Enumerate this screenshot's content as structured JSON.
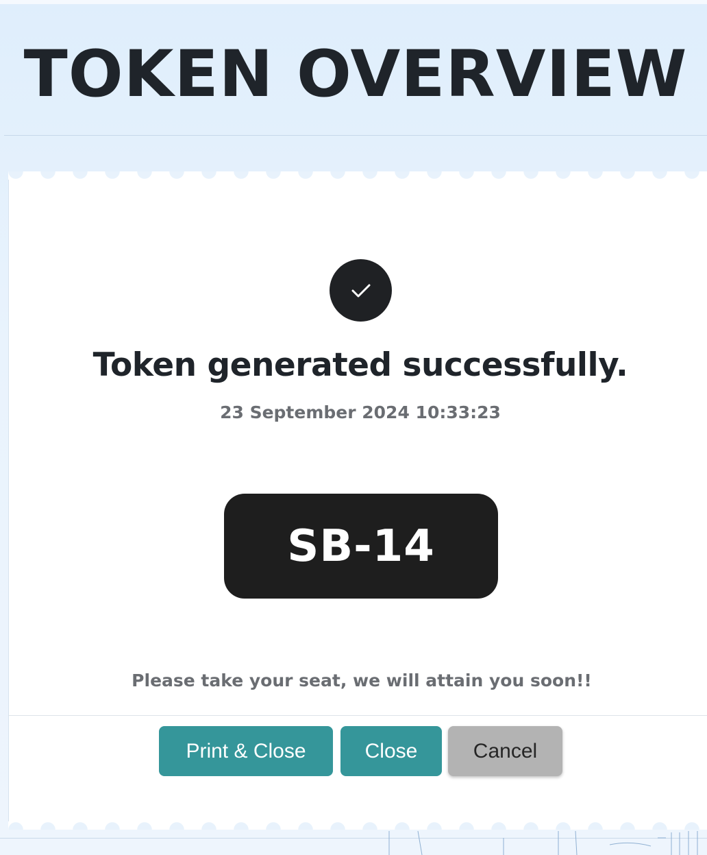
{
  "header": {
    "title": "TOKEN OVERVIEW"
  },
  "result": {
    "icon": "check-circle-icon",
    "message": "Token generated successfully.",
    "timestamp": "23 September 2024 10:33:23",
    "token": "SB-14",
    "note": "Please take your seat, we will attain you soon!!"
  },
  "actions": {
    "print_close_label": "Print & Close",
    "close_label": "Close",
    "cancel_label": "Cancel"
  },
  "colors": {
    "primary_button": "#35969a",
    "secondary_button": "#b3b3b3",
    "token_background": "#1e1e1e",
    "page_background": "#e8f2fc"
  }
}
